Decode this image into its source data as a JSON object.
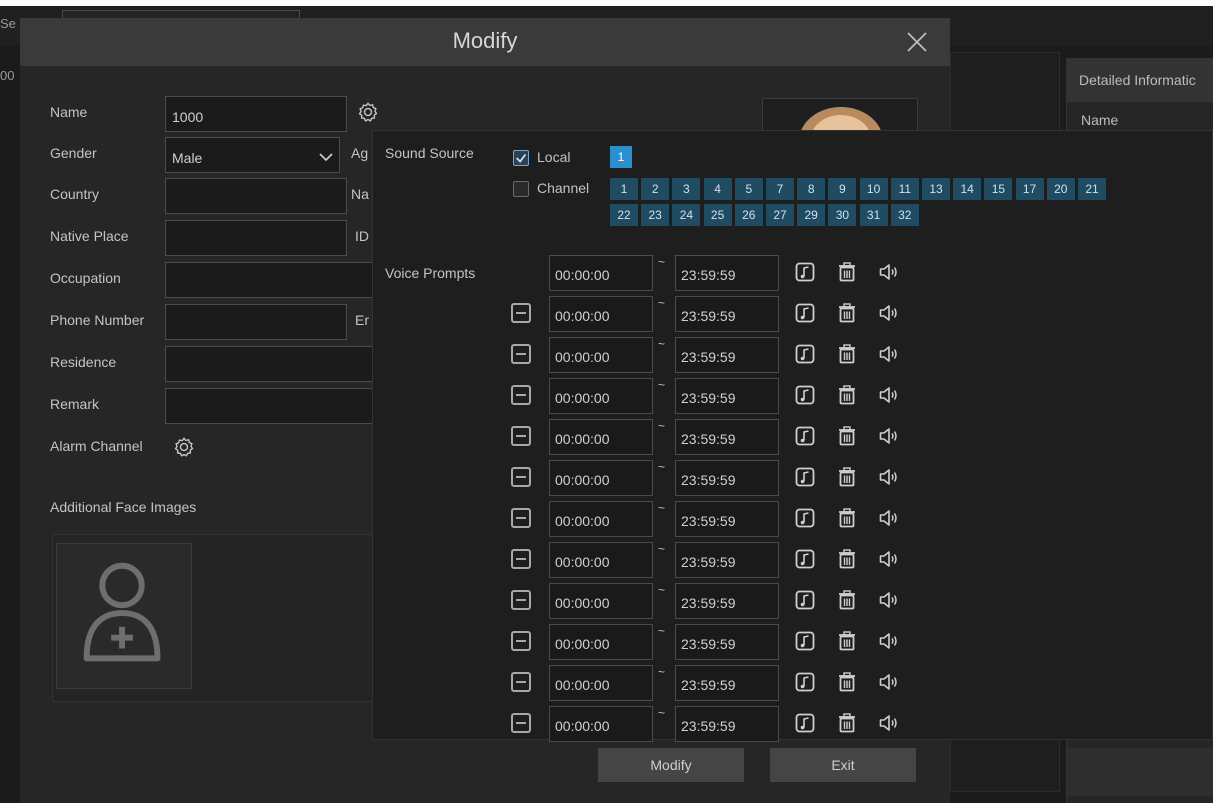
{
  "background": {
    "side_fragment_top": "Se",
    "side_fragment_mid": "00",
    "right_panel_title": "Detailed Informatic",
    "right_panel_name_label": "Name"
  },
  "dialog": {
    "title": "Modify",
    "form": {
      "name_label": "Name",
      "name_value": "1000",
      "gender_label": "Gender",
      "gender_value": "Male",
      "age_label_fragment": "Ag",
      "country_label": "Country",
      "country_value": "",
      "nation_label_fragment": "Na",
      "native_place_label": "Native Place",
      "native_place_value": "",
      "id_label_fragment": "ID",
      "occupation_label": "Occupation",
      "occupation_value": "",
      "phone_label": "Phone Number",
      "phone_value": "",
      "email_label_fragment": "Er",
      "residence_label": "Residence",
      "residence_value": "",
      "remark_label": "Remark",
      "remark_value": "",
      "alarm_channel_label": "Alarm Channel",
      "additional_faces_label": "Additional Face Images"
    },
    "buttons": {
      "modify": "Modify",
      "exit": "Exit"
    }
  },
  "voice_panel": {
    "sound_source_label": "Sound Source",
    "local_label": "Local",
    "local_checked": true,
    "local_channel": "1",
    "channel_label": "Channel",
    "channel_checked": false,
    "channels_row1": [
      "1",
      "2",
      "3",
      "4",
      "5",
      "7",
      "8",
      "9",
      "10",
      "11",
      "13",
      "14",
      "15",
      "17",
      "20",
      "21"
    ],
    "channels_row2": [
      "22",
      "23",
      "24",
      "25",
      "26",
      "27",
      "29",
      "30",
      "31",
      "32"
    ],
    "voice_prompts_label": "Voice Prompts",
    "tilde": "~",
    "prompts": [
      {
        "start": "00:00:00",
        "end": "23:59:59"
      },
      {
        "start": "00:00:00",
        "end": "23:59:59"
      },
      {
        "start": "00:00:00",
        "end": "23:59:59"
      },
      {
        "start": "00:00:00",
        "end": "23:59:59"
      },
      {
        "start": "00:00:00",
        "end": "23:59:59"
      },
      {
        "start": "00:00:00",
        "end": "23:59:59"
      },
      {
        "start": "00:00:00",
        "end": "23:59:59"
      },
      {
        "start": "00:00:00",
        "end": "23:59:59"
      },
      {
        "start": "00:00:00",
        "end": "23:59:59"
      },
      {
        "start": "00:00:00",
        "end": "23:59:59"
      },
      {
        "start": "00:00:00",
        "end": "23:59:59"
      },
      {
        "start": "00:00:00",
        "end": "23:59:59"
      }
    ],
    "icons": {
      "file": "music-file-icon",
      "delete": "trash-icon",
      "play": "speaker-icon",
      "remove": "minus-square-icon"
    }
  }
}
